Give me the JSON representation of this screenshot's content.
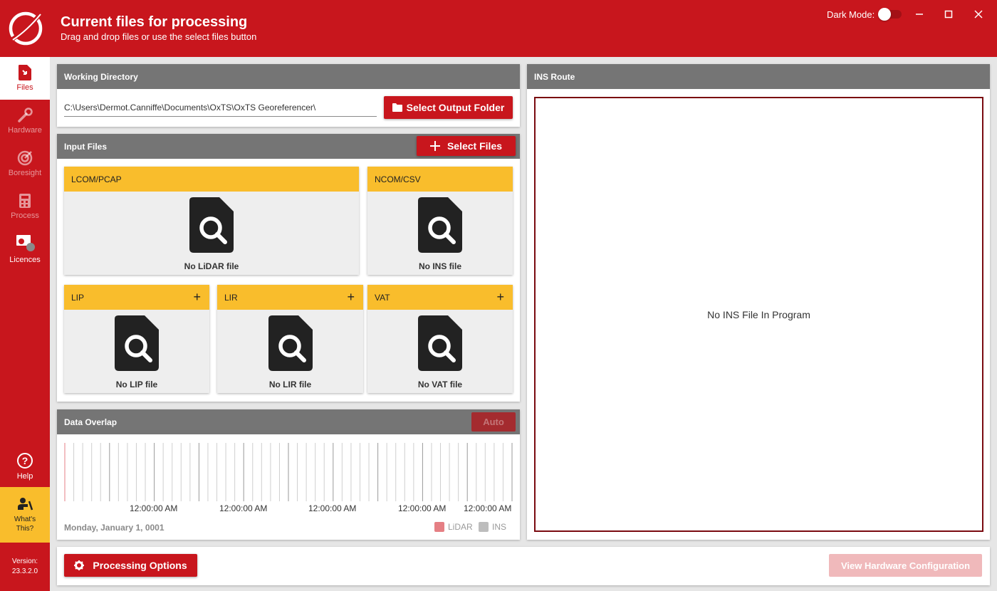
{
  "header": {
    "title": "Current files for processing",
    "subtitle": "Drag and drop files or use the select files button",
    "dark_mode_label": "Dark Mode:",
    "dark_mode_on": false,
    "accent_color": "#c8161d"
  },
  "sidebar": {
    "items": [
      {
        "label": "Files",
        "icon": "file-import-icon",
        "active": true
      },
      {
        "label": "Hardware",
        "icon": "tools-icon"
      },
      {
        "label": "Boresight",
        "icon": "target-icon"
      },
      {
        "label": "Process",
        "icon": "calculator-icon"
      },
      {
        "label": "Licences",
        "icon": "certificate-icon"
      }
    ],
    "help_label": "Help",
    "whats_this_line1": "What's",
    "whats_this_line2": "This?",
    "version_label": "Version:",
    "version_number": "23.3.2.0"
  },
  "working_directory": {
    "title": "Working Directory",
    "path": "C:\\Users\\Dermot.Canniffe\\Documents\\OxTS\\OxTS Georeferencer\\",
    "select_button": "Select Output Folder"
  },
  "input_files": {
    "title": "Input Files",
    "select_button": "Select Files",
    "cards": {
      "lcom": {
        "title": "LCOM/PCAP",
        "empty": "No LiDAR file"
      },
      "ncom": {
        "title": "NCOM/CSV",
        "empty": "No INS file"
      },
      "lip": {
        "title": "LIP",
        "empty": "No LIP file"
      },
      "lir": {
        "title": "LIR",
        "empty": "No LIR file"
      },
      "vat": {
        "title": "VAT",
        "empty": "No VAT file"
      }
    }
  },
  "data_overlap": {
    "title": "Data Overlap",
    "auto_button": "Auto",
    "tick_labels": [
      "12:00:00 AM",
      "12:00:00 AM",
      "12:00:00 AM",
      "12:00:00 AM",
      "12:00:00 AM"
    ],
    "date": "Monday, January 1, 0001",
    "legend": [
      {
        "name": "LiDAR",
        "color": "#e57f84"
      },
      {
        "name": "INS",
        "color": "#bdbdbd"
      }
    ]
  },
  "ins_route": {
    "title": "INS Route",
    "empty_message": "No INS File In Program"
  },
  "footer": {
    "processing_options": "Processing Options",
    "view_hardware": "View Hardware Configuration"
  }
}
